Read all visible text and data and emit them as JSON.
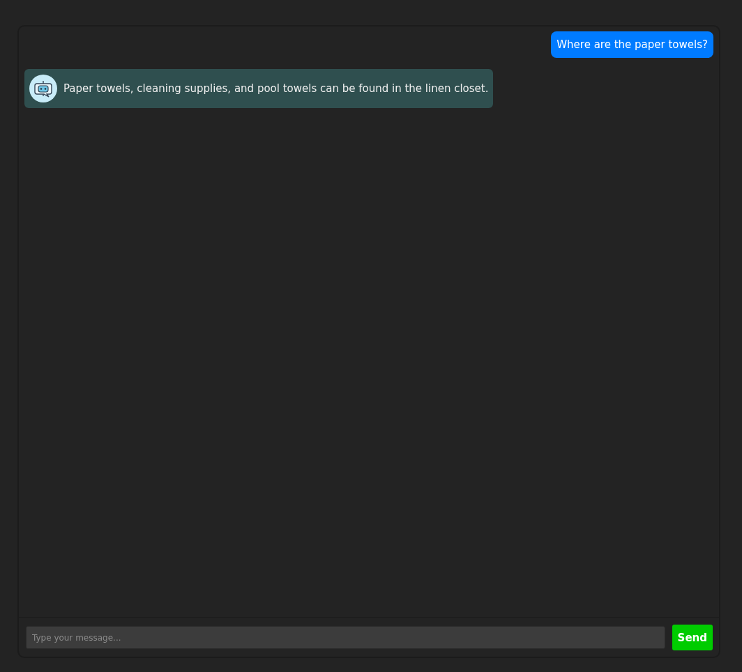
{
  "messages": [
    {
      "kind": "user",
      "text": "Where are the paper towels?"
    },
    {
      "kind": "bot",
      "text": "Paper towels, cleaning supplies, and pool towels can be found in the linen closet."
    }
  ],
  "composer": {
    "placeholder": "Type your message...",
    "send_label": "Send"
  }
}
